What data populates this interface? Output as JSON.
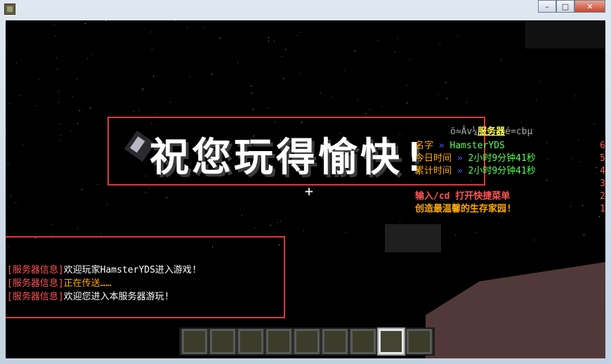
{
  "window": {
    "controls": [
      "–",
      "□",
      "✕"
    ],
    "icon": "minecraft-app-icon"
  },
  "game": {
    "title_text": "祝您玩得愉快!",
    "crosshair": "+"
  },
  "scoreboard": {
    "title_garbled_left": "ö≈Âv¼",
    "title_main": "服务器",
    "title_garbled_right": "é=cbµ",
    "rows": [
      {
        "label": "名字",
        "arrow": "»",
        "value": "HamsterYDS",
        "score": "6"
      },
      {
        "label": "今日时间",
        "arrow": "»",
        "value": "2小时9分钟41秒",
        "score": "5"
      },
      {
        "label": "累计时间",
        "arrow": "»",
        "value": "2小时9分钟41秒",
        "score": "4"
      },
      {
        "label": "",
        "arrow": "",
        "value": "",
        "score": "3"
      },
      {
        "text": "输入/cd 打开快捷菜单",
        "score": "2"
      },
      {
        "text": "创造最温馨的生存家园!",
        "score": "1"
      }
    ]
  },
  "chat": [
    {
      "prefix": "[服务器信息]",
      "message": "欢迎玩家HamsterYDS进入游戏!"
    },
    {
      "prefix": "[服务器信息]",
      "message": "正在传送……"
    },
    {
      "prefix": "[服务器信息]",
      "message": "欢迎您进入本服务器游玩!"
    }
  ],
  "hotbar": {
    "slot_count": 9,
    "selected_slot": 7
  },
  "colors": {
    "highlight_box": "#d93a3a",
    "chat_prefix": "#ff5555",
    "scoreboard_label": "#ffaa00",
    "scoreboard_value": "#55ff55",
    "scoreboard_title": "#ffff55"
  }
}
